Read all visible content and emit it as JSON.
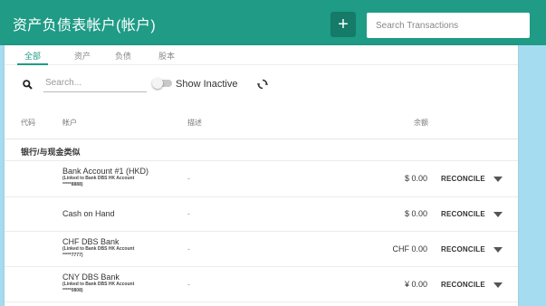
{
  "header": {
    "title": "资产负债表帐户(帐户)",
    "add_label": "+",
    "search_placeholder": "Search Transactions"
  },
  "tabs": [
    {
      "label": "全部",
      "active": true
    },
    {
      "label": "资产",
      "active": false
    },
    {
      "label": "负债",
      "active": false
    },
    {
      "label": "股本",
      "active": false
    }
  ],
  "filters": {
    "search_placeholder": "Search...",
    "show_inactive_label": "Show Inactive",
    "show_inactive": false
  },
  "columns": {
    "code": "代码",
    "account": "帐户",
    "description": "描述",
    "balance": "余额"
  },
  "group": {
    "title": "银行/与现金类似"
  },
  "rows": [
    {
      "name": "Bank Account #1 (HKD)",
      "sub1": "(Linked to Bank DBS HK Account",
      "sub2": "*****8888)",
      "description": "-",
      "balance": "$ 0.00",
      "action": "RECONCILE"
    },
    {
      "name": "Cash on Hand",
      "sub1": "",
      "sub2": "",
      "description": "-",
      "balance": "$ 0.00",
      "action": "RECONCILE"
    },
    {
      "name": "CHF DBS Bank",
      "sub1": "(Linked to Bank DBS HK Account",
      "sub2": "*****7777)",
      "description": "-",
      "balance": "CHF 0.00",
      "action": "RECONCILE"
    },
    {
      "name": "CNY DBS Bank",
      "sub1": "(Linked to Bank DBS HK Account",
      "sub2": "*****0808)",
      "description": "-",
      "balance": "¥ 0.00",
      "action": "RECONCILE"
    }
  ],
  "colors": {
    "brand": "#1f9b86",
    "page_bg": "#a6dcef"
  }
}
